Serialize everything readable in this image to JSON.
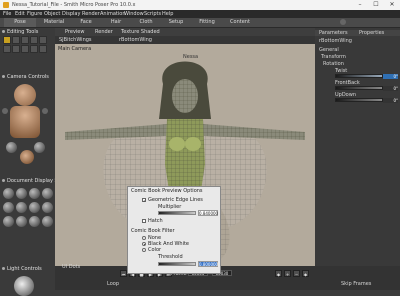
{
  "window": {
    "title": "Nessa_Tutorial_File - Smith Micro Poser Pro 10.0.x"
  },
  "menu": [
    "File",
    "Edit",
    "Figure",
    "Object",
    "Display",
    "Render",
    "Animation",
    "Window",
    "Scripts",
    "Help"
  ],
  "rooms": [
    "Pose",
    "Material",
    "Face",
    "Hair",
    "Cloth",
    "Setup",
    "Fitting",
    "Content"
  ],
  "left_panel": {
    "editing_tools": "Editing Tools",
    "camera_controls": "Camera Controls",
    "document_display": "Document Display S",
    "light_controls": "Light Controls",
    "ui_dots": "UI Dots"
  },
  "viewport": {
    "tabs": [
      "Preview",
      "Render",
      "Texture Shaded"
    ],
    "figure_label": "SJBitchWings",
    "actor_label": "rBottomWing",
    "camera": "Main Camera",
    "watermark": "Nessa"
  },
  "right_panel": {
    "tabs": [
      "Parameters",
      "Properties"
    ],
    "actor": "rBottomWing",
    "group_general": "General",
    "group_transform": "Transform",
    "group_rotation": "Rotation",
    "params": [
      {
        "name": "Twist",
        "value": "0°",
        "highlight": true
      },
      {
        "name": "FrontBack",
        "value": "0°",
        "highlight": false
      },
      {
        "name": "UpDown",
        "value": "0°",
        "highlight": false
      }
    ]
  },
  "dialog": {
    "title": "Comic Book Preview Options",
    "edge_label": "Geometric Edge Lines",
    "edge_checked": "✓",
    "multiplier_label": "Multiplier",
    "multiplier_value": "0.840000",
    "hatch_label": "Hatch",
    "filter_label": "Comic Book Filter",
    "options": [
      {
        "label": "None",
        "checked": false
      },
      {
        "label": "Black And White",
        "checked": true
      },
      {
        "label": "Color",
        "checked": false
      }
    ],
    "threshold_label": "Threshold",
    "threshold_value": "0.800000"
  },
  "playback": {
    "frame_label": "Frame",
    "frame_current": "00001",
    "frame_total": "00030",
    "loop_label": "Loop",
    "skip_label": "Skip Frames"
  },
  "colors": {
    "accent": "#2f6fb3",
    "viewport_bg": "#b3aa9c",
    "selected_tool": "#c8a020"
  }
}
